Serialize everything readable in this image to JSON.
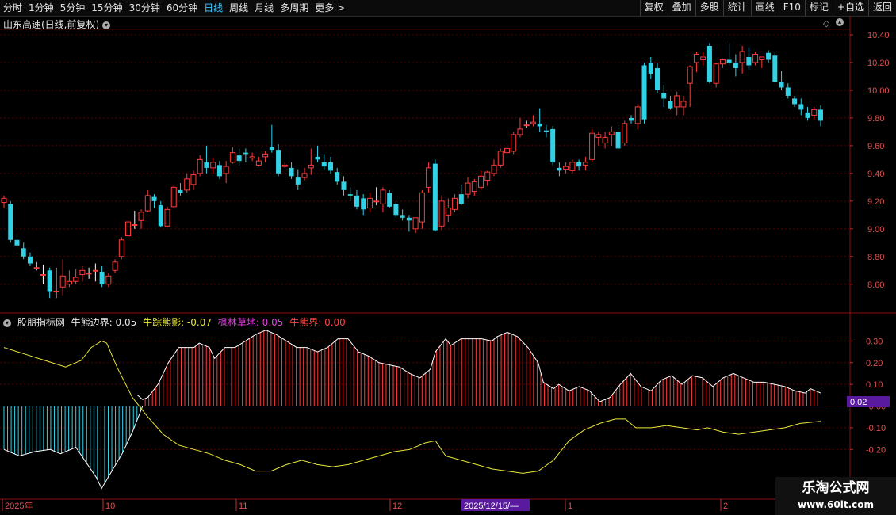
{
  "toolbar": {
    "periods": [
      "分时",
      "1分钟",
      "5分钟",
      "15分钟",
      "30分钟",
      "60分钟",
      "日线",
      "周线",
      "月线",
      "多周期",
      "更多 >"
    ],
    "active_period": "日线",
    "right_buttons": [
      "复权",
      "叠加",
      "多股",
      "统计",
      "画线",
      "F10",
      "标记",
      "+自选",
      "返回"
    ]
  },
  "main_chart": {
    "title": "山东高速(日线,前复权)",
    "price_ticks": [
      "10.40",
      "10.20",
      "10.00",
      "9.80",
      "9.60",
      "9.40",
      "9.20",
      "9.00",
      "8.80",
      "8.60"
    ]
  },
  "indicator": {
    "name": "股朋指标网",
    "items": [
      {
        "label": "牛熊边界: 0.05",
        "color": "#e6e6e6"
      },
      {
        "label": "牛踪熊影: -0.07",
        "color": "#e8e83a"
      },
      {
        "label": "枫林草地: 0.05",
        "color": "#e040e0"
      },
      {
        "label": "牛熊界: 0.00",
        "color": "#ff4040"
      }
    ],
    "ticks": [
      "0.30",
      "0.20",
      "0.10",
      "-0.00",
      "-0.10",
      "-0.20"
    ],
    "current_value": "0.02"
  },
  "date_axis": {
    "labels": [
      "2025年",
      "10",
      "11",
      "12",
      "1",
      "2"
    ],
    "cursor_date": "2025/12/15/—"
  },
  "watermark": {
    "line1": "乐淘公式网",
    "line2": "www.60lt.com"
  },
  "colors": {
    "up": "#ff3c3c",
    "down": "#32d2e6",
    "yellow_line": "#e8e83a",
    "grid": "#5a0000"
  },
  "chart_data": {
    "type": "candlestick",
    "title": "山东高速(日线,前复权)",
    "ylim": [
      8.45,
      10.48
    ],
    "candles": [
      [
        9.19,
        9.24,
        9.15,
        9.22
      ],
      [
        9.18,
        9.2,
        8.9,
        8.92
      ],
      [
        8.92,
        8.96,
        8.86,
        8.88
      ],
      [
        8.86,
        8.9,
        8.78,
        8.8
      ],
      [
        8.8,
        8.83,
        8.73,
        8.75
      ],
      [
        8.72,
        8.76,
        8.7,
        8.72
      ],
      [
        8.67,
        8.74,
        8.6,
        8.67
      ],
      [
        8.7,
        8.72,
        8.5,
        8.55
      ],
      [
        8.55,
        8.72,
        8.5,
        8.55
      ],
      [
        8.58,
        8.78,
        8.52,
        8.66
      ],
      [
        8.6,
        8.7,
        8.58,
        8.62
      ],
      [
        8.62,
        8.71,
        8.6,
        8.65
      ],
      [
        8.67,
        8.73,
        8.62,
        8.7
      ],
      [
        8.68,
        8.72,
        8.64,
        8.68
      ],
      [
        8.7,
        8.75,
        8.62,
        8.7
      ],
      [
        8.69,
        8.73,
        8.58,
        8.6
      ],
      [
        8.6,
        8.68,
        8.58,
        8.66
      ],
      [
        8.7,
        8.78,
        8.68,
        8.76
      ],
      [
        8.8,
        8.94,
        8.78,
        8.92
      ],
      [
        8.95,
        9.06,
        8.93,
        9.05
      ],
      [
        9.03,
        9.13,
        9.0,
        9.03
      ],
      [
        9.06,
        9.14,
        9.0,
        9.12
      ],
      [
        9.13,
        9.28,
        9.12,
        9.24
      ],
      [
        9.23,
        9.25,
        9.15,
        9.2
      ],
      [
        9.17,
        9.2,
        9.01,
        9.02
      ],
      [
        9.02,
        9.16,
        9.01,
        9.14
      ],
      [
        9.16,
        9.32,
        9.15,
        9.3
      ],
      [
        9.28,
        9.33,
        9.24,
        9.26
      ],
      [
        9.28,
        9.4,
        9.26,
        9.36
      ],
      [
        9.32,
        9.42,
        9.28,
        9.39
      ],
      [
        9.4,
        9.53,
        9.38,
        9.5
      ],
      [
        9.48,
        9.6,
        9.4,
        9.44
      ],
      [
        9.44,
        9.51,
        9.4,
        9.48
      ],
      [
        9.46,
        9.49,
        9.36,
        9.38
      ],
      [
        9.4,
        9.49,
        9.33,
        9.45
      ],
      [
        9.48,
        9.59,
        9.47,
        9.55
      ],
      [
        9.53,
        9.58,
        9.46,
        9.49
      ],
      [
        9.55,
        9.58,
        9.48,
        9.54
      ],
      [
        9.51,
        9.55,
        9.49,
        9.52
      ],
      [
        9.46,
        9.52,
        9.45,
        9.49
      ],
      [
        9.52,
        9.56,
        9.48,
        9.54
      ],
      [
        9.59,
        9.75,
        9.55,
        9.57
      ],
      [
        9.57,
        9.61,
        9.38,
        9.4
      ],
      [
        9.45,
        9.48,
        9.44,
        9.46
      ],
      [
        9.44,
        9.48,
        9.36,
        9.38
      ],
      [
        9.37,
        9.43,
        9.28,
        9.32
      ],
      [
        9.37,
        9.44,
        9.35,
        9.4
      ],
      [
        9.44,
        9.58,
        9.39,
        9.46
      ],
      [
        9.52,
        9.6,
        9.48,
        9.5
      ],
      [
        9.48,
        9.54,
        9.43,
        9.45
      ],
      [
        9.48,
        9.52,
        9.4,
        9.42
      ],
      [
        9.41,
        9.44,
        9.32,
        9.34
      ],
      [
        9.34,
        9.38,
        9.24,
        9.28
      ],
      [
        9.25,
        9.3,
        9.2,
        9.24
      ],
      [
        9.24,
        9.28,
        9.14,
        9.16
      ],
      [
        9.22,
        9.25,
        9.1,
        9.14
      ],
      [
        9.15,
        9.26,
        9.12,
        9.22
      ],
      [
        9.2,
        9.3,
        9.17,
        9.2
      ],
      [
        9.18,
        9.3,
        9.12,
        9.28
      ],
      [
        9.26,
        9.28,
        9.15,
        9.16
      ],
      [
        9.18,
        9.2,
        9.08,
        9.1
      ],
      [
        9.1,
        9.14,
        9.06,
        9.08
      ],
      [
        9.08,
        9.1,
        8.98,
        9.06
      ],
      [
        9.0,
        9.08,
        8.97,
        9.08
      ],
      [
        9.05,
        9.28,
        9.0,
        9.26
      ],
      [
        9.3,
        9.48,
        9.26,
        9.44
      ],
      [
        9.47,
        9.5,
        8.98,
        8.99
      ],
      [
        9.02,
        9.24,
        8.99,
        9.2
      ],
      [
        9.1,
        9.22,
        9.05,
        9.15
      ],
      [
        9.14,
        9.25,
        9.12,
        9.22
      ],
      [
        9.25,
        9.32,
        9.17,
        9.18
      ],
      [
        9.25,
        9.37,
        9.22,
        9.33
      ],
      [
        9.27,
        9.36,
        9.24,
        9.34
      ],
      [
        9.3,
        9.42,
        9.28,
        9.38
      ],
      [
        9.35,
        9.42,
        9.31,
        9.41
      ],
      [
        9.4,
        9.5,
        9.38,
        9.46
      ],
      [
        9.46,
        9.58,
        9.44,
        9.56
      ],
      [
        9.55,
        9.62,
        9.53,
        9.58
      ],
      [
        9.56,
        9.7,
        9.54,
        9.68
      ],
      [
        9.68,
        9.8,
        9.66,
        9.72
      ],
      [
        9.75,
        9.78,
        9.73,
        9.75
      ],
      [
        9.76,
        9.82,
        9.74,
        9.77
      ],
      [
        9.76,
        9.87,
        9.7,
        9.74
      ],
      [
        9.71,
        9.75,
        9.66,
        9.7
      ],
      [
        9.72,
        9.74,
        9.46,
        9.48
      ],
      [
        9.44,
        9.48,
        9.38,
        9.42
      ],
      [
        9.43,
        9.48,
        9.4,
        9.45
      ],
      [
        9.42,
        9.5,
        9.4,
        9.48
      ],
      [
        9.48,
        9.5,
        9.42,
        9.45
      ],
      [
        9.46,
        9.52,
        9.42,
        9.48
      ],
      [
        9.5,
        9.72,
        9.48,
        9.69
      ],
      [
        9.66,
        9.7,
        9.6,
        9.68
      ],
      [
        9.62,
        9.7,
        9.58,
        9.66
      ],
      [
        9.68,
        9.74,
        9.6,
        9.7
      ],
      [
        9.7,
        9.75,
        9.56,
        9.58
      ],
      [
        9.62,
        9.78,
        9.6,
        9.76
      ],
      [
        9.8,
        9.82,
        9.76,
        9.78
      ],
      [
        9.76,
        9.9,
        9.72,
        9.88
      ],
      [
        10.18,
        10.2,
        9.76,
        9.79
      ],
      [
        10.2,
        10.24,
        10.08,
        10.12
      ],
      [
        10.16,
        10.2,
        9.98,
        10.0
      ],
      [
        9.98,
        10.04,
        9.88,
        9.94
      ],
      [
        9.92,
        9.96,
        9.86,
        9.87
      ],
      [
        9.88,
        9.99,
        9.82,
        9.96
      ],
      [
        9.88,
        9.96,
        9.82,
        9.92
      ],
      [
        10.05,
        10.18,
        9.88,
        10.17
      ],
      [
        10.2,
        10.28,
        10.13,
        10.26
      ],
      [
        10.22,
        10.28,
        10.18,
        10.24
      ],
      [
        10.32,
        10.34,
        10.05,
        10.06
      ],
      [
        10.05,
        10.2,
        10.02,
        10.19
      ],
      [
        10.19,
        10.23,
        10.16,
        10.22
      ],
      [
        10.22,
        10.34,
        10.18,
        10.2
      ],
      [
        10.2,
        10.26,
        10.1,
        10.16
      ],
      [
        10.2,
        10.32,
        10.12,
        10.28
      ],
      [
        10.24,
        10.31,
        10.15,
        10.18
      ],
      [
        10.2,
        10.28,
        10.18,
        10.26
      ],
      [
        10.22,
        10.24,
        10.16,
        10.24
      ],
      [
        10.27,
        10.29,
        10.2,
        10.22
      ],
      [
        10.25,
        10.28,
        10.08,
        10.06
      ],
      [
        10.06,
        10.14,
        10.0,
        10.02
      ],
      [
        10.02,
        10.05,
        9.94,
        9.96
      ],
      [
        9.94,
        9.96,
        9.88,
        9.9
      ],
      [
        9.9,
        9.94,
        9.82,
        9.86
      ],
      [
        9.84,
        9.88,
        9.78,
        9.8
      ],
      [
        9.82,
        9.88,
        9.79,
        9.86
      ],
      [
        9.86,
        9.89,
        9.74,
        9.78
      ]
    ],
    "oscillator": {
      "x_range": [
        0,
        125
      ],
      "ylim": [
        -0.4,
        0.4
      ],
      "white_line": [
        [
          0,
          0.26
        ],
        [
          2,
          0.25
        ],
        [
          4,
          0.24
        ],
        [
          6,
          0.22
        ],
        [
          9,
          0.2
        ],
        [
          12,
          0.18
        ],
        [
          14,
          0.2
        ],
        [
          16,
          0.25
        ],
        [
          17,
          0.3
        ],
        [
          19,
          0.31
        ],
        [
          20,
          0.3
        ],
        [
          22,
          0.2
        ],
        [
          24,
          0.1
        ],
        [
          26,
          0.05
        ],
        [
          27,
          0.03
        ],
        [
          28,
          0.04
        ],
        [
          30,
          0.1
        ],
        [
          32,
          0.2
        ],
        [
          34,
          0.27
        ],
        [
          37,
          0.27
        ],
        [
          38,
          0.29
        ],
        [
          40,
          0.27
        ],
        [
          41,
          0.22
        ],
        [
          43,
          0.27
        ],
        [
          45,
          0.27
        ],
        [
          47,
          0.3
        ],
        [
          49,
          0.33
        ],
        [
          51,
          0.35
        ],
        [
          53,
          0.33
        ],
        [
          55,
          0.3
        ],
        [
          57,
          0.27
        ],
        [
          59,
          0.27
        ],
        [
          61,
          0.25
        ],
        [
          63,
          0.27
        ],
        [
          65,
          0.31
        ],
        [
          67,
          0.31
        ],
        [
          69,
          0.25
        ],
        [
          71,
          0.23
        ],
        [
          73,
          0.2
        ],
        [
          75,
          0.19
        ],
        [
          77,
          0.18
        ],
        [
          79,
          0.15
        ],
        [
          81,
          0.13
        ],
        [
          83,
          0.17
        ],
        [
          84,
          0.25
        ],
        [
          86,
          0.31
        ],
        [
          87,
          0.28
        ],
        [
          89,
          0.31
        ],
        [
          91,
          0.31
        ],
        [
          93,
          0.31
        ],
        [
          95,
          0.3
        ],
        [
          96,
          0.32
        ],
        [
          98,
          0.34
        ],
        [
          100,
          0.32
        ],
        [
          102,
          0.27
        ],
        [
          104,
          0.2
        ],
        [
          105,
          0.11
        ],
        [
          107,
          0.08
        ],
        [
          108,
          0.1
        ],
        [
          110,
          0.07
        ],
        [
          112,
          0.09
        ],
        [
          114,
          0.07
        ],
        [
          116,
          0.02
        ],
        [
          118,
          0.04
        ],
        [
          120,
          0.1
        ],
        [
          122,
          0.15
        ],
        [
          124,
          0.09
        ],
        [
          126,
          0.07
        ],
        [
          128,
          0.12
        ],
        [
          130,
          0.14
        ],
        [
          132,
          0.1
        ],
        [
          134,
          0.14
        ],
        [
          136,
          0.13
        ],
        [
          138,
          0.09
        ],
        [
          140,
          0.13
        ],
        [
          142,
          0.15
        ],
        [
          144,
          0.13
        ],
        [
          146,
          0.11
        ],
        [
          148,
          0.11
        ],
        [
          150,
          0.1
        ],
        [
          152,
          0.09
        ],
        [
          154,
          0.07
        ],
        [
          156,
          0.06
        ],
        [
          157,
          0.08
        ],
        [
          159,
          0.06
        ]
      ],
      "yellow_line": [
        [
          0,
          0.27
        ],
        [
          4,
          0.24
        ],
        [
          8,
          0.21
        ],
        [
          12,
          0.18
        ],
        [
          15,
          0.21
        ],
        [
          17,
          0.27
        ],
        [
          19,
          0.3
        ],
        [
          20,
          0.29
        ],
        [
          22,
          0.18
        ],
        [
          25,
          0.04
        ],
        [
          28,
          -0.05
        ],
        [
          31,
          -0.13
        ],
        [
          34,
          -0.18
        ],
        [
          37,
          -0.2
        ],
        [
          40,
          -0.22
        ],
        [
          43,
          -0.25
        ],
        [
          46,
          -0.27
        ],
        [
          49,
          -0.3
        ],
        [
          52,
          -0.3
        ],
        [
          55,
          -0.27
        ],
        [
          58,
          -0.25
        ],
        [
          61,
          -0.27
        ],
        [
          64,
          -0.28
        ],
        [
          67,
          -0.27
        ],
        [
          70,
          -0.25
        ],
        [
          73,
          -0.23
        ],
        [
          76,
          -0.21
        ],
        [
          79,
          -0.2
        ],
        [
          82,
          -0.17
        ],
        [
          84,
          -0.16
        ],
        [
          86,
          -0.23
        ],
        [
          89,
          -0.25
        ],
        [
          92,
          -0.27
        ],
        [
          95,
          -0.29
        ],
        [
          98,
          -0.3
        ],
        [
          101,
          -0.31
        ],
        [
          104,
          -0.3
        ],
        [
          107,
          -0.25
        ],
        [
          110,
          -0.16
        ],
        [
          113,
          -0.11
        ],
        [
          116,
          -0.08
        ],
        [
          119,
          -0.06
        ],
        [
          121,
          -0.06
        ],
        [
          123,
          -0.1
        ],
        [
          126,
          -0.1
        ],
        [
          129,
          -0.09
        ],
        [
          132,
          -0.1
        ],
        [
          135,
          -0.11
        ],
        [
          137,
          -0.1
        ],
        [
          140,
          -0.12
        ],
        [
          143,
          -0.13
        ],
        [
          146,
          -0.12
        ],
        [
          149,
          -0.11
        ],
        [
          152,
          -0.1
        ],
        [
          155,
          -0.08
        ],
        [
          159,
          -0.07
        ]
      ]
    }
  }
}
